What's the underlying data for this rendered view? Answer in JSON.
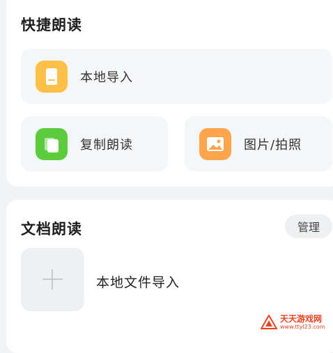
{
  "quick_read": {
    "title": "快捷朗读",
    "items": [
      {
        "label": "本地导入",
        "icon": "file-icon",
        "color": "#ffc049"
      },
      {
        "label": "复制朗读",
        "icon": "copy-icon",
        "color": "#5dcc3c"
      },
      {
        "label": "图片/拍照",
        "icon": "image-icon",
        "color": "#ffa54c"
      }
    ]
  },
  "doc_read": {
    "title": "文档朗读",
    "manage_label": "管理",
    "add_icon": "plus-icon",
    "import_label": "本地文件导入"
  },
  "watermark": {
    "title": "天天游戏网",
    "url": "www.ttyl23.com"
  }
}
